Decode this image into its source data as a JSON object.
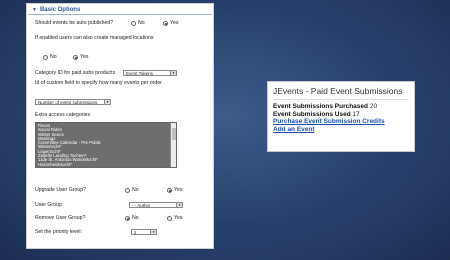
{
  "panel": {
    "header": "Basic Options",
    "auto_publish_label": "Should events be auto published?",
    "no": "No",
    "yes": "Yes",
    "managed_locations_label": "If enabled users can also create managed locations",
    "category_label": "Category ID for paid subs products",
    "category_value": "Event Tokens",
    "custom_field_label": "Id of custom field to specify how many events per order",
    "custom_field_value": "Number of event submissions",
    "extra_access_label": "Extra access categories",
    "access_categories": [
      "Races",
      "Social Rides",
      "Winter Series",
      "Meetings",
      "Committee Calendar - Pre Public",
      "Wintertocht*",
      "Lispertocht*",
      "Zadelle Landing Tochten*",
      "11de St. Antonius Wandeltocht*",
      "Hazenheidetocht*"
    ],
    "upgrade_group_label": "Upgrade User Group?",
    "user_group_label": "User Group:",
    "user_group_value": "- - Author",
    "remove_group_label": "Remove User Group?",
    "priority_label": "Set the priority level:",
    "priority_value": "2"
  },
  "card": {
    "title": "JEvents - Paid Event Submissions",
    "purchased_label": "Event Submissions Purchased",
    "purchased_value": "20",
    "used_label": "Event Submissions Used",
    "used_value": "17",
    "link_purchase": "Purchase Event Submission Credits",
    "link_add": "Add an Event"
  }
}
